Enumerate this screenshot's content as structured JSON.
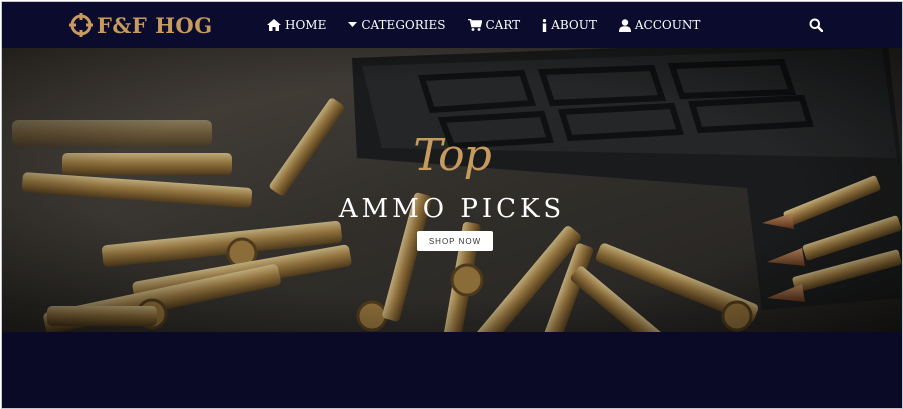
{
  "brand": {
    "name": "F&F HOG",
    "logo_icon": "crosshair-icon",
    "brand_color": "#c79a5e"
  },
  "nav": {
    "items": [
      {
        "label": "HOME",
        "icon": "home-icon"
      },
      {
        "label": "CATEGORIES",
        "icon": "caret-down-icon"
      },
      {
        "label": "CART",
        "icon": "cart-icon"
      },
      {
        "label": "ABOUT",
        "icon": "info-icon"
      },
      {
        "label": "ACCOUNT",
        "icon": "user-icon"
      }
    ],
    "search_icon": "search-icon",
    "background": "#0b0b2e"
  },
  "hero": {
    "script_text": "Top",
    "title": "AMMO PICKS",
    "cta_label": "SHOP NOW"
  }
}
